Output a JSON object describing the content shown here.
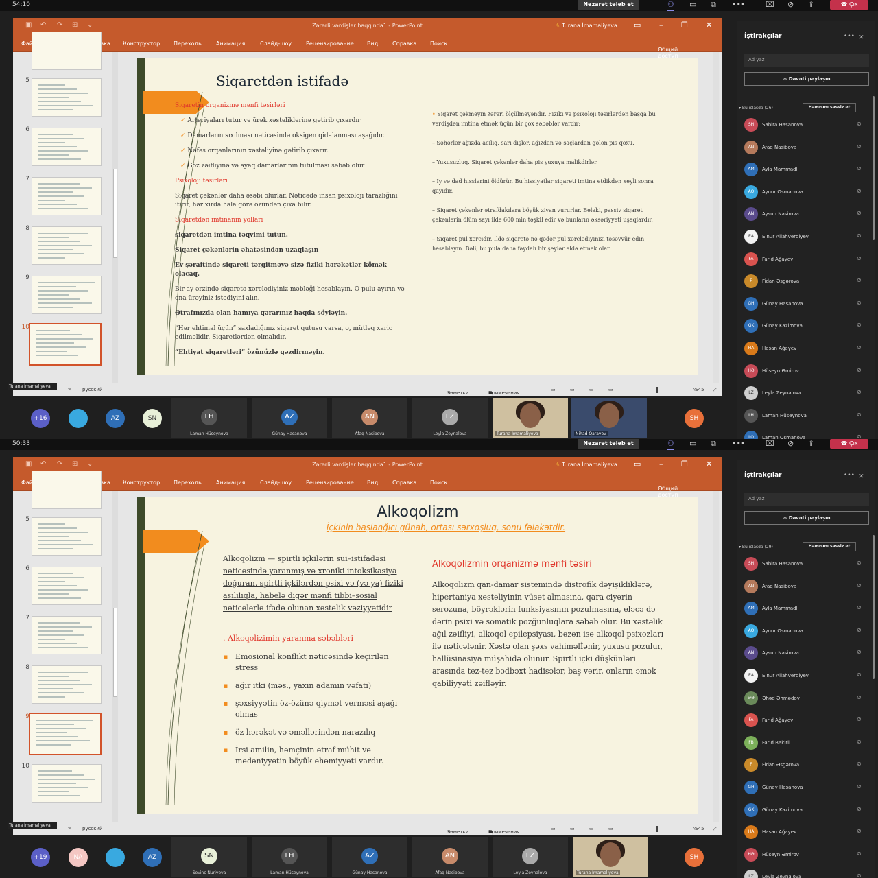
{
  "frames": [
    {
      "clock": "54:10",
      "request_control": "Nəzarət tələb et",
      "leave_label": "Çıx",
      "ppt": {
        "title": "Zərərli vərdişlər haqqında1 - PowerPoint",
        "user": "Turana İmamaliyeva",
        "menu": [
          "Файл",
          "Главная",
          "Вставка",
          "Конструктор",
          "Переходы",
          "Анимация",
          "Слайд-шоу",
          "Рецензирование",
          "Вид",
          "Справка",
          "Поиск"
        ],
        "share": "Общий доступ",
        "thumb_numbers": [
          "5",
          "6",
          "7",
          "8",
          "9",
          "10"
        ],
        "selected_index": 5,
        "status": {
          "lang": "русский",
          "notes": "Заметки",
          "comments": "Примечания",
          "zoom": "%45"
        },
        "presenter_tag": "Turana İmamaliyeva"
      },
      "slide": {
        "title": "Siqaretdən istifadə",
        "left": [
          {
            "t": "h",
            "text": "Siqaretin orqanizmə mənfi təsirləri"
          },
          {
            "t": "c",
            "text": "Arteriyaları tutur və ürək xəstəliklərinə gətirib çıxardır"
          },
          {
            "t": "c",
            "text": "Damarların sıxılması nəticəsində oksigen qidalanması aşağıdır."
          },
          {
            "t": "c",
            "text": "Nəfəs orqanlarının xəstəliyinə gətirib çıxarır."
          },
          {
            "t": "c",
            "text": "Göz zəifliyinə və ayaq damarlarının tutulması səbəb olur"
          },
          {
            "t": "h",
            "text": "Psixoloji təsirləri"
          },
          {
            "t": "p",
            "text": "Siqaret çəkənlər daha əsəbi olurlar. Nəticədə insan psixoloji tarazlığını itirir, hər xırda hala görə özündən çıxa bilir."
          },
          {
            "t": "h",
            "text": "Siqaretdən imtinanın yolları"
          },
          {
            "t": "b",
            "text": "siqaretdən imtina təqvimi tutun."
          },
          {
            "t": "b",
            "text": "Siqaret çəkənlərin əhatəsindən uzaqlaşın"
          },
          {
            "t": "b",
            "text": "Ev şəraitində siqareti tərgitməyə sizə fiziki hərəkətlər kömək olacaq."
          },
          {
            "t": "p",
            "text": "Bir ay ərzində siqaretə xərclədiyiniz məbləği hesablayın. O pulu ayırın və ona ürəyiniz istədiyini alın."
          },
          {
            "t": "b",
            "text": "Ətrafınızda olan hamıya qərarınız haqda söyləyin."
          },
          {
            "t": "p",
            "text": "“Hər ehtimal üçün” saxladığınız siqaret qutusu varsa, o, mütləq xaric edilməlidir. Siqaretlərdən olmalıdır."
          },
          {
            "t": "b",
            "text": "“Ehtiyat siqaretləri” özünüzlə gəzdirməyin."
          }
        ],
        "right": [
          "Siqaret çəkməyin zərəri ölçülməyəndir. Fiziki və psixoloji təsirlərdən başqa bu vərdişdən imtina etmək üçün bir çox səbəblər vardır:",
          "– Səhərlər ağızda acılıq, sarı dişlər, ağızdan və saçlardan gələn pis qoxu.",
          "– Yuxusuzluq. Siqaret çəkənlər daha pis yuxuya malikdirlər.",
          "– İy və dad hisslərini öldürür. Bu hissiyatlar siqareti imtina etdikdən xeyli sonra qayıdır.",
          "– Siqaret çəkənlər ətrafdakılara böyük ziyan vururlar. Beləki, passiv siqaret çəkənlərin ölüm sayı ildə 600 min təşkil edir və bunların əksəriyyəti uşaqlardır.",
          "– Siqaret pul xərcidir. İldə siqaretə nə qədər pul xərclədiyinizi təsəvvür edin, hesablayın. Bəli, bu pula daha faydalı bir şeylər əldə etmək olar."
        ]
      },
      "strip": {
        "count": "+16",
        "small": [
          {
            "label": "",
            "color": "#39a9e0"
          },
          {
            "label": "AZ",
            "color": "#2f6fb7"
          },
          {
            "label": "SN",
            "color": "#e8f0d8"
          }
        ],
        "tiles": [
          {
            "initials": "LH",
            "name": "Laman Hüseynova",
            "color": "#555"
          },
          {
            "initials": "AZ",
            "name": "Günay Hasanova",
            "color": "#2f6fb7"
          },
          {
            "initials": "AN",
            "name": "Afaq Nasibova",
            "color": "#c78a6a"
          },
          {
            "initials": "LZ",
            "name": "Leyla Zeynalova",
            "color": "#aaa"
          }
        ],
        "videos": [
          {
            "name": "Turana İmamaliyeva"
          },
          {
            "name": "Nihad Qarayev"
          }
        ],
        "self": "SH"
      },
      "panel": {
        "title": "İştirakçılar",
        "search_placeholder": "Ad yaz",
        "invite": "Dəvəti paylaşın",
        "count": "Bu iclasda (26)",
        "mute_all": "Hamısını səssiz et",
        "people": [
          {
            "i": "SH",
            "n": "Sabira Hasanova",
            "c": "#c74b57"
          },
          {
            "i": "AN",
            "n": "Afaq Nasibova",
            "c": "#b57a5c"
          },
          {
            "i": "AM",
            "n": "Ayla Mammadli",
            "c": "#2f6fb7"
          },
          {
            "i": "AO",
            "n": "Aynur Osmanova",
            "c": "#39a9e0"
          },
          {
            "i": "AN",
            "n": "Aysun Nasirova",
            "c": "#5a4b8c"
          },
          {
            "i": "EA",
            "n": "Elnur Allahverdiyev",
            "c": "#f2f2f2"
          },
          {
            "i": "FA",
            "n": "Farid Ağayev",
            "c": "#d9534f"
          },
          {
            "i": "F",
            "n": "Fidan Əsgərova",
            "c": "#c98a2a"
          },
          {
            "i": "GH",
            "n": "Günay Hasanova",
            "c": "#2f6fb7"
          },
          {
            "i": "GK",
            "n": "Günay Kazimova",
            "c": "#2f6fb7"
          },
          {
            "i": "HA",
            "n": "Hasan Ağayev",
            "c": "#d97a1a"
          },
          {
            "i": "HƏ",
            "n": "Hüseyn Əmirov",
            "c": "#c74b57"
          },
          {
            "i": "LZ",
            "n": "Leyla Zeynalova",
            "c": "#cfcfcf"
          },
          {
            "i": "LH",
            "n": "Laman Hüseynova",
            "c": "#555"
          },
          {
            "i": "LO",
            "n": "Laman Osmanova",
            "c": "#2f6fb7"
          }
        ]
      }
    },
    {
      "clock": "50:33",
      "request_control": "Nəzarət tələb et",
      "leave_label": "Çıx",
      "ppt": {
        "title": "Zərərli vərdişlər haqqında1 - PowerPoint",
        "user": "Turana İmamaliyeva",
        "menu": [
          "Файл",
          "Главная",
          "Вставка",
          "Конструктор",
          "Переходы",
          "Анимация",
          "Слайд-шоу",
          "Рецензирование",
          "Вид",
          "Справка",
          "Поиск"
        ],
        "share": "Общий доступ",
        "thumb_numbers": [
          "5",
          "6",
          "7",
          "8",
          "9",
          "10"
        ],
        "selected_index": 4,
        "status": {
          "lang": "русский",
          "notes": "Заметки",
          "comments": "Примечания",
          "zoom": "%45"
        },
        "presenter_tag": "Turana İmamaliyeva"
      },
      "slide": {
        "title": "Alkoqolizm",
        "subtitle": "İçkinin başlanğıcı günah, ortası sərxoşluq, sonu fəlakətdir.",
        "left_para": "Alkoqolizm — spirtli içkilərin sui–istifadəsi nəticəsində yaranmış və xroniki intoksikasiya doğuran, spirtli içkilərdən psixi və (və ya) fiziki asılılıqla, habelə digər mənfi tibbi–sosial nəticələrlə ifadə olunan xəstəlik vəziyyətidir",
        "causes_title": ". Alkoqolizimin yaranma səbəbləri",
        "causes": [
          "Emosional konflikt nəticəsində keçirilən stress",
          "ağır itki (məs., yaxın adamın vəfatı)",
          "şəxsiyyətin öz-özünə qiymət verməsi aşağı olmas",
          "öz hərəkət və əməllərindən narazılıq",
          "İrsi amilin, həmçinin ətraf mühit və mədəniyyətin böyük əhəmiyyəti vardır."
        ],
        "right_title": "Alkoqolizmin orqanizmə mənfi təsiri",
        "right_para": "Alkoqolizm qan-damar sistemində distrofik dəyişikliklərə, hipertaniya xəstəliyinin vüsət almasına, qara ciyərin serozuna, böyrəklərin funksiyasının pozulmasına, eləcə də dərin psixi və somatik pozğunluqlara səbəb olur. Bu xəstəlik ağıl zəifliyi, alkoqol epilepsiyası, bəzən isə alkoqol psixozları ilə nəticələnir. Xəstə olan şəxs vahiməlİənir, yuxusu pozulur, hallüsinasiya müşahidə olunur. Spirtli içki düşkünləri arasında tez-tez bədbəxt hadisələr, baş verir, onların əmək qabiliyyəti zəifləyir."
      },
      "strip": {
        "count": "+19",
        "small": [
          {
            "label": "NA",
            "color": "#f4c7c3"
          },
          {
            "label": "",
            "color": "#39a9e0"
          },
          {
            "label": "AZ",
            "color": "#2f6fb7"
          }
        ],
        "tiles": [
          {
            "initials": "SN",
            "name": "Sevinc Nuriyeva",
            "color": "#e8f0d8"
          },
          {
            "initials": "LH",
            "name": "Laman Hüseynova",
            "color": "#555"
          },
          {
            "initials": "AZ",
            "name": "Günay Hasanova",
            "color": "#2f6fb7"
          },
          {
            "initials": "AN",
            "name": "Afaq Nasibova",
            "color": "#c78a6a"
          },
          {
            "initials": "LZ",
            "name": "Leyla Zeynalova",
            "color": "#aaa"
          }
        ],
        "videos": [
          {
            "name": "Turana İmamaliyeva"
          }
        ],
        "self": "SH"
      },
      "panel": {
        "title": "İştirakçılar",
        "search_placeholder": "Ad yaz",
        "invite": "Dəvəti paylaşın",
        "count": "Bu iclasda (29)",
        "mute_all": "Hamısını səssiz et",
        "people": [
          {
            "i": "SH",
            "n": "Sabira Hasanova",
            "c": "#c74b57"
          },
          {
            "i": "AN",
            "n": "Afaq Nasibova",
            "c": "#b57a5c"
          },
          {
            "i": "AM",
            "n": "Ayla Mammadli",
            "c": "#2f6fb7"
          },
          {
            "i": "AO",
            "n": "Aynur Osmanova",
            "c": "#39a9e0"
          },
          {
            "i": "AN",
            "n": "Aysun Nasirova",
            "c": "#5a4b8c"
          },
          {
            "i": "EA",
            "n": "Elnur Allahverdiyev",
            "c": "#f2f2f2"
          },
          {
            "i": "ƏƏ",
            "n": "Əhəd Əhmədov",
            "c": "#6a8a5a"
          },
          {
            "i": "FA",
            "n": "Farid Ağayev",
            "c": "#d9534f"
          },
          {
            "i": "FB",
            "n": "Farid Bakirli",
            "c": "#7cb05a"
          },
          {
            "i": "F",
            "n": "Fidan Əsgərova",
            "c": "#c98a2a"
          },
          {
            "i": "GH",
            "n": "Günay Hasanova",
            "c": "#2f6fb7"
          },
          {
            "i": "GK",
            "n": "Günay Kazimova",
            "c": "#2f6fb7"
          },
          {
            "i": "HA",
            "n": "Hasan Ağayev",
            "c": "#d97a1a"
          },
          {
            "i": "HƏ",
            "n": "Hüseyn Əmirov",
            "c": "#c74b57"
          },
          {
            "i": "LZ",
            "n": "Leyla Zeynalova",
            "c": "#cfcfcf"
          }
        ]
      }
    }
  ]
}
